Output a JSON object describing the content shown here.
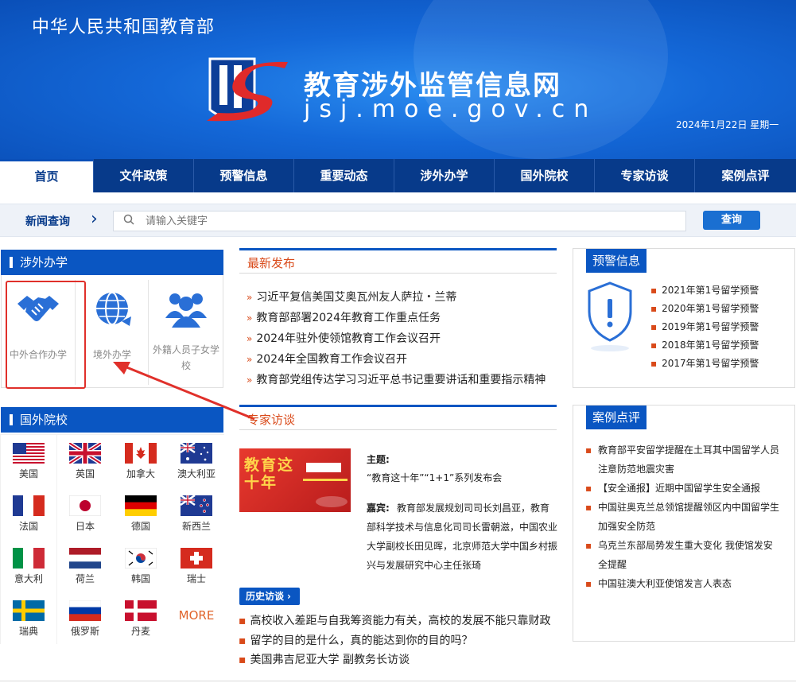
{
  "header": {
    "ministry": "中华人民共和国教育部",
    "site_title": "教育涉外监管信息网",
    "site_url": "jsj.moe.gov.cn",
    "date": "2024年1月22日 星期一"
  },
  "nav": {
    "items": [
      {
        "label": "首页",
        "active": true
      },
      {
        "label": "文件政策"
      },
      {
        "label": "预警信息"
      },
      {
        "label": "重要动态"
      },
      {
        "label": "涉外办学"
      },
      {
        "label": "国外院校"
      },
      {
        "label": "专家访谈"
      },
      {
        "label": "案例点评"
      }
    ]
  },
  "search": {
    "label": "新闻查询",
    "placeholder": "请输入关键字",
    "button": "查询"
  },
  "foreign_schools_section": {
    "title": "涉外办学",
    "items": [
      {
        "label": "中外合作办学",
        "icon": "handshake-icon",
        "selected": true
      },
      {
        "label": "境外办学",
        "icon": "globe-icon"
      },
      {
        "label": "外籍人员子女学校",
        "icon": "people-icon"
      }
    ]
  },
  "overseas_schools": {
    "title": "国外院校",
    "countries": [
      {
        "name": "美国"
      },
      {
        "name": "英国"
      },
      {
        "name": "加拿大"
      },
      {
        "name": "澳大利亚"
      },
      {
        "name": "法国"
      },
      {
        "name": "日本"
      },
      {
        "name": "德国"
      },
      {
        "name": "新西兰"
      },
      {
        "name": "意大利"
      },
      {
        "name": "荷兰"
      },
      {
        "name": "韩国"
      },
      {
        "name": "瑞士"
      },
      {
        "name": "瑞典"
      },
      {
        "name": "俄罗斯"
      },
      {
        "name": "丹麦"
      }
    ],
    "more": "MORE"
  },
  "latest": {
    "title": "最新发布",
    "items": [
      "习近平复信美国艾奥瓦州友人萨拉・兰蒂",
      "教育部部署2024年教育工作重点任务",
      "2024年驻外使领馆教育工作会议召开",
      "2024年全国教育工作会议召开",
      "教育部党组传达学习习近平总书记重要讲话和重要指示精神"
    ]
  },
  "interview": {
    "title": "专家访谈",
    "image_text": "教育这十年",
    "topic_label": "主题:",
    "topic": "“教育这十年”“1+1”系列发布会",
    "guests_label": "嘉宾:",
    "guests_lines": [
      "教育部发展规划司司长刘昌亚，教育",
      "部科学技术与信息化司司长雷朝滋，中国农业",
      "大学副校长田见晖，北京师范大学中国乡村振",
      "兴与发展研究中心主任张琦"
    ],
    "history_button": "历史访谈",
    "history_items": [
      "高校收入差距与自我筹资能力有关，高校的发展不能只靠财政",
      "留学的目的是什么，真的能达到你的目的吗？",
      "美国弗吉尼亚大学 副教务长访谈"
    ]
  },
  "warnings": {
    "title": "预警信息",
    "items": [
      "2021年第1号留学预警",
      "2020年第1号留学预警",
      "2019年第1号留学预警",
      "2018年第1号留学预警",
      "2017年第1号留学预警"
    ]
  },
  "cases": {
    "title": "案例点评",
    "items": [
      [
        "教育部平安留学提醒在土耳其中国留学人员",
        "注意防范地震灾害"
      ],
      [
        "【安全通报】近期中国留学生安全通报"
      ],
      [
        "中国驻奥克兰总领馆提醒领区内中国留学生",
        "加强安全防范"
      ],
      [
        "乌克兰东部局势发生重大变化 我使馆发安",
        "全提醒"
      ],
      [
        "中国驻澳大利亚使馆发言人表态"
      ]
    ]
  },
  "colors": {
    "primary": "#0a56c2",
    "nav_bg": "#073a8a",
    "accent": "#d94a1a",
    "annotation": "#e0302a"
  }
}
